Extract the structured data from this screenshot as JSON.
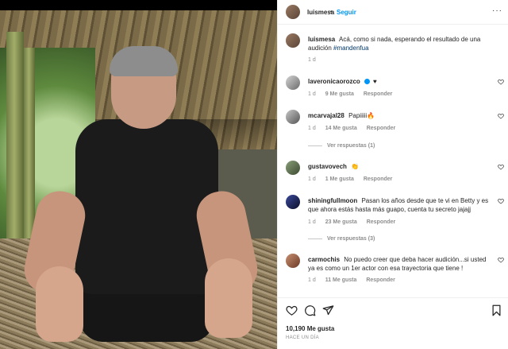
{
  "header": {
    "username": "luismesa",
    "dot": "•",
    "follow_label": "Seguir",
    "more": "···"
  },
  "comments": [
    {
      "username": "luismesa",
      "text": "Acá, como si nada, esperando el resultado de una audición",
      "hashtag": "#mandenfua",
      "time": "1 d"
    },
    {
      "username": "laveronicaorozco",
      "text": "♥",
      "time": "1 d",
      "likes": "9 Me gusta",
      "reply": "Responder"
    },
    {
      "username": "mcarvajal28",
      "text": "Papiiiii🔥",
      "time": "1 d",
      "likes": "14 Me gusta",
      "reply": "Responder",
      "view_replies": "Ver respuestas (1)"
    },
    {
      "username": "gustavovech",
      "text": "👏",
      "time": "1 d",
      "likes": "1 Me gusta",
      "reply": "Responder"
    },
    {
      "username": "shiningfullmoon",
      "text": "Pasan los años desde que te vi en Betty y es que ahora estás hasta más guapo, cuenta tu secreto jajajj",
      "time": "1 d",
      "likes": "23 Me gusta",
      "reply": "Responder",
      "view_replies": "Ver respuestas (3)"
    },
    {
      "username": "carmochis",
      "text": "No puedo creer que deba hacer audición...si usted ya es como un 1er actor con esa trayectoria que tiene !",
      "time": "1 d",
      "likes": "11 Me gusta",
      "reply": "Responder"
    }
  ],
  "footer": {
    "likes": "10,190 Me gusta",
    "date": "HACE UN DÍA"
  },
  "colors": {
    "accent": "#0095f6",
    "text": "#262626",
    "muted": "#8e8e8e"
  },
  "icons": [
    "heart-icon",
    "comment-icon",
    "share-icon",
    "bookmark-icon",
    "verified-badge-icon"
  ]
}
